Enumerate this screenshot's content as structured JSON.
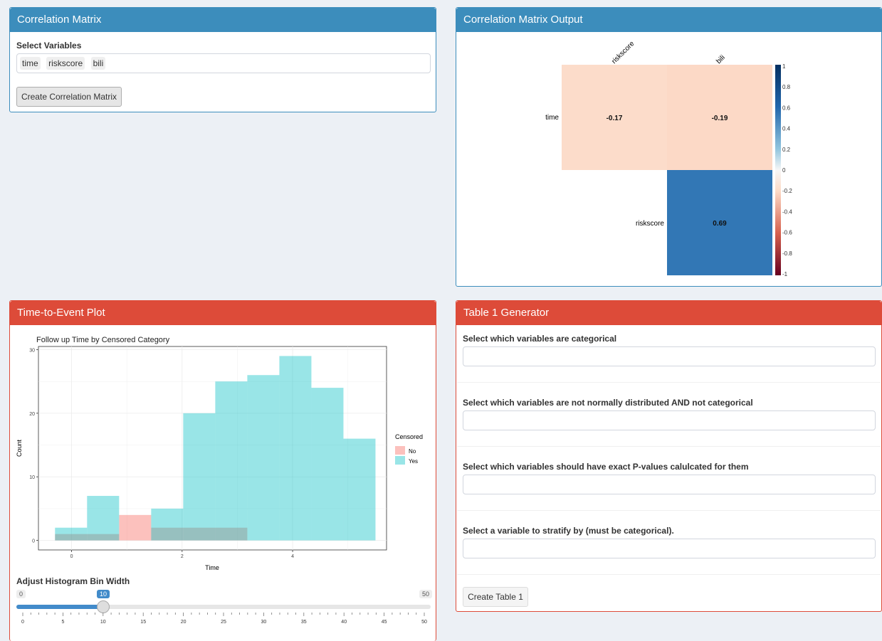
{
  "corr_input": {
    "title": "Correlation Matrix",
    "select_label": "Select Variables",
    "selected": [
      "time",
      "riskscore",
      "bili"
    ],
    "button": "Create Correlation Matrix"
  },
  "corr_output": {
    "title": "Correlation Matrix Output",
    "col_labels": [
      "riskscore",
      "bili"
    ],
    "row_labels": [
      "time",
      "riskscore"
    ],
    "cells": [
      {
        "row": 0,
        "col": 0,
        "value": -0.17,
        "label": "-0.17",
        "color": "#fcdcca"
      },
      {
        "row": 0,
        "col": 1,
        "value": -0.19,
        "label": "-0.19",
        "color": "#fcd9c6"
      },
      {
        "row": 1,
        "col": 1,
        "value": 0.69,
        "label": "0.69",
        "color": "#3277b5"
      }
    ],
    "colorbar_ticks": [
      "1",
      "0.8",
      "0.6",
      "0.4",
      "0.2",
      "0",
      "-0.2",
      "-0.4",
      "-0.6",
      "-0.8",
      "-1"
    ]
  },
  "tte": {
    "title": "Time-to-Event Plot",
    "slider_label": "Adjust Histogram Bin Width",
    "slider_min": "0",
    "slider_max": "50",
    "slider_value": "10",
    "slider_ticks": [
      "0",
      "5",
      "10",
      "15",
      "20",
      "25",
      "30",
      "35",
      "40",
      "45",
      "50"
    ]
  },
  "chart_data": {
    "type": "bar",
    "title": "Follow up Time by Censored Category",
    "xlabel": "Time",
    "ylabel": "Count",
    "x_ticks": [
      "0",
      "2",
      "4"
    ],
    "y_ticks": [
      "0",
      "10",
      "20",
      "30"
    ],
    "xlim": [
      -0.6,
      5.7
    ],
    "ylim": [
      -1.5,
      30.5
    ],
    "bin_edges": [
      -0.3,
      0.28,
      0.86,
      1.44,
      2.02,
      2.6,
      3.18,
      3.76,
      4.34,
      4.92,
      5.5
    ],
    "legend_title": "Censored",
    "legend_position": "right",
    "series": [
      {
        "name": "No",
        "color": "#f8766d",
        "values": [
          1,
          1,
          4,
          2,
          2,
          2,
          0,
          0,
          0,
          0
        ]
      },
      {
        "name": "Yes",
        "color": "#00bfc4",
        "values": [
          2,
          7,
          0,
          5,
          20,
          25,
          26,
          29,
          24,
          16
        ]
      }
    ]
  },
  "table1": {
    "title": "Table 1 Generator",
    "q1": "Select which variables are categorical",
    "q2": "Select which variables are not normally distributed AND not categorical",
    "q3": "Select which variables should have exact P-values calulcated for them",
    "q4": "Select a variable to stratify by (must be categorical).",
    "button": "Create Table 1"
  }
}
